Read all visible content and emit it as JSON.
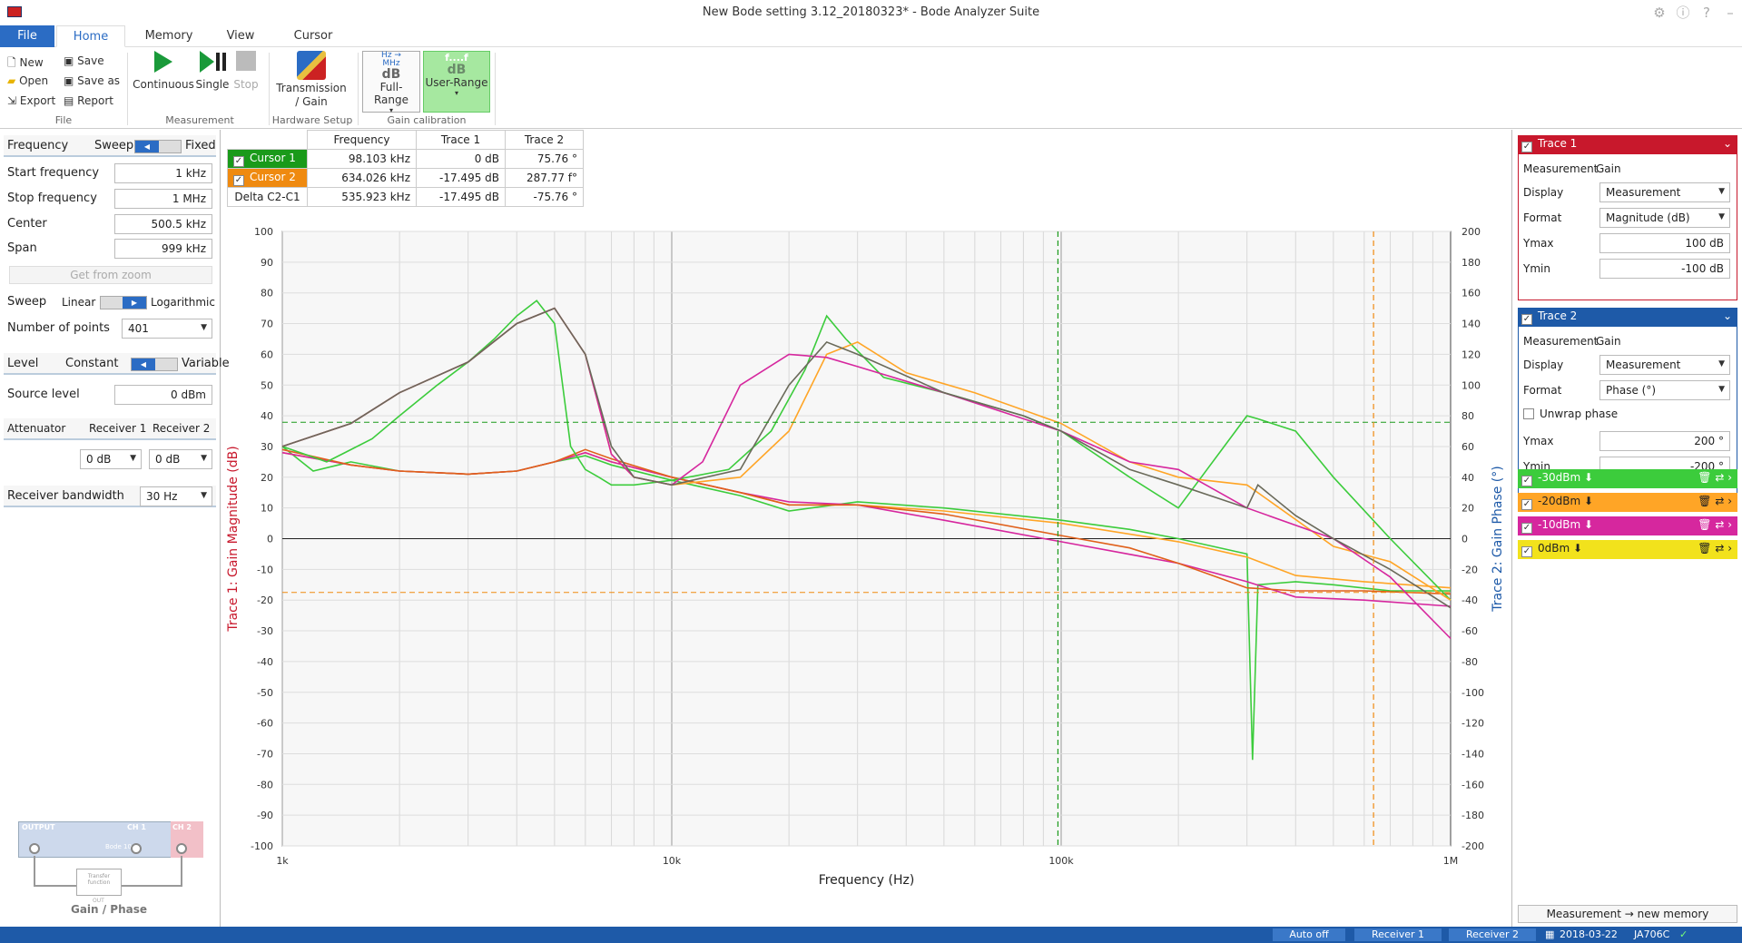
{
  "window": {
    "title": "New Bode setting 3.12_20180323* - Bode Analyzer Suite"
  },
  "tabs": [
    "File",
    "Home",
    "Memory",
    "View",
    "Cursor"
  ],
  "ribbon": {
    "file_items": [
      "New",
      "Open",
      "Export",
      "Save",
      "Save as",
      "Report"
    ],
    "file_group": "File",
    "continuous": "Continuous",
    "single": "Single",
    "stop": "Stop",
    "measurement_group": "Measurement",
    "transmission": "Transmission",
    "gain": "/ Gain",
    "hardware_group": "Hardware Setup",
    "full_range": "Full-Range",
    "user_range": "User-Range",
    "calib_group": "Gain calibration",
    "hz_label": "Hz",
    "mhz_label": "MHz",
    "db_label": "dB",
    "f_label": "f....f"
  },
  "left": {
    "frequency": "Frequency",
    "sweep": "Sweep",
    "fixed": "Fixed",
    "start_label": "Start frequency",
    "start_value": "1 kHz",
    "stop_label": "Stop frequency",
    "stop_value": "1 MHz",
    "center_label": "Center",
    "center_value": "500.5 kHz",
    "span_label": "Span",
    "span_value": "999 kHz",
    "get_from_zoom": "Get from zoom",
    "sweep_label": "Sweep",
    "linear": "Linear",
    "logarithmic": "Logarithmic",
    "points_label": "Number of points",
    "points_value": "401",
    "level": "Level",
    "constant": "Constant",
    "variable": "Variable",
    "source_label": "Source level",
    "source_value": "0 dBm",
    "attenuator": "Attenuator",
    "receiver1": "Receiver 1",
    "receiver2": "Receiver 2",
    "att1": "0 dB",
    "att2": "0 dB",
    "bandwidth_label": "Receiver bandwidth",
    "bandwidth_value": "30 Hz",
    "diagram_output": "OUTPUT",
    "diagram_ch1": "CH 1",
    "diagram_ch2": "CH 2",
    "diagram_device": "Bode 100",
    "diagram_tf": "Transfer function",
    "diagram_out": "OUT",
    "diagram_title": "Gain / Phase"
  },
  "cursor_table": {
    "headers": [
      "Frequency",
      "Trace 1",
      "Trace 2"
    ],
    "rows": [
      {
        "name": "Cursor 1",
        "freq": "98.103 kHz",
        "t1": "0 dB",
        "t2": "75.76 °",
        "color": "#1a9a1a"
      },
      {
        "name": "Cursor 2",
        "freq": "634.026 kHz",
        "t1": "-17.495 dB",
        "t2": "287.77 f°",
        "color": "#ef8a10"
      },
      {
        "name": "Delta C2-C1",
        "freq": "535.923 kHz",
        "t1": "-17.495 dB",
        "t2": "-75.76 °",
        "color": ""
      }
    ]
  },
  "right": {
    "trace1": {
      "title": "Trace 1",
      "measurement_label": "Measurement",
      "measurement": "Gain",
      "display_label": "Display",
      "display": "Measurement",
      "format_label": "Format",
      "format": "Magnitude (dB)",
      "ymax_label": "Ymax",
      "ymax": "100 dB",
      "ymin_label": "Ymin",
      "ymin": "-100 dB",
      "color": "#c8182c"
    },
    "trace2": {
      "title": "Trace 2",
      "measurement_label": "Measurement",
      "measurement": "Gain",
      "display_label": "Display",
      "display": "Measurement",
      "format_label": "Format",
      "format": "Phase (°)",
      "unwrap": "Unwrap phase",
      "ymax_label": "Ymax",
      "ymax": "200 °",
      "ymin_label": "Ymin",
      "ymin": "-200 °",
      "color": "#1e5aa8"
    },
    "memories": [
      {
        "label": "-30dBm",
        "color": "#3ccc3c"
      },
      {
        "label": "-20dBm",
        "color": "#ffa526"
      },
      {
        "label": "-10dBm",
        "color": "#d6279e"
      },
      {
        "label": "0dBm",
        "color": "#f2e21c"
      }
    ],
    "new_memory": "Measurement → new memory"
  },
  "status": {
    "auto": "Auto off",
    "r1": "Receiver 1",
    "r2": "Receiver 2",
    "date": "2018-03-22",
    "device": "JA706C"
  },
  "chart_data": {
    "type": "line",
    "xlabel": "Frequency (Hz)",
    "ylabel_left": "Trace 1: Gain Magnitude (dB)",
    "ylabel_right": "Trace 2: Gain Phase (°)",
    "xscale": "log",
    "xlim": [
      1000,
      1000000
    ],
    "ylim_left": [
      -100,
      100
    ],
    "ylim_right": [
      -200,
      200
    ],
    "x_ticks": [
      "1k",
      "10k",
      "100k",
      "1M"
    ],
    "y_ticks_left": [
      100,
      90,
      80,
      70,
      60,
      50,
      40,
      30,
      20,
      10,
      0,
      -10,
      -20,
      -30,
      -40,
      -50,
      -60,
      -70,
      -80,
      -90,
      -100
    ],
    "y_ticks_right": [
      200,
      180,
      160,
      140,
      120,
      100,
      80,
      60,
      40,
      20,
      0,
      -20,
      -40,
      -60,
      -80,
      -100,
      -120,
      -140,
      -160,
      -180,
      -200
    ],
    "cursor1_hz": 98103,
    "cursor2_hz": 634026,
    "cursor1_db": 37.9,
    "cursor2_db": -17.495,
    "series": [
      {
        "name": "-30dBm",
        "color": "#3ccc3c",
        "axis": "left",
        "x": [
          1000,
          1200,
          1500,
          2000,
          3000,
          4000,
          5000,
          6000,
          7000,
          10000,
          15000,
          20000,
          30000,
          50000,
          100000,
          150000,
          200000,
          300000,
          310000,
          320000,
          400000,
          500000,
          700000,
          1000000
        ],
        "y": [
          30,
          22,
          25,
          22,
          21,
          22,
          25,
          27,
          24,
          19,
          14,
          9,
          12,
          10,
          6,
          3,
          0,
          -5,
          -72,
          -15,
          -14,
          -15,
          -17,
          -17
        ]
      },
      {
        "name": "-20dBm",
        "color": "#ffa526",
        "axis": "left",
        "x": [
          1000,
          1500,
          2000,
          3000,
          4000,
          5000,
          6000,
          7000,
          10000,
          15000,
          20000,
          30000,
          50000,
          100000,
          200000,
          300000,
          400000,
          600000,
          1000000
        ],
        "y": [
          28,
          24,
          22,
          21,
          22,
          25,
          28,
          25,
          20,
          15,
          11,
          11,
          9,
          5,
          -1,
          -6,
          -12,
          -14,
          -16
        ]
      },
      {
        "name": "-10dBm",
        "color": "#d6279e",
        "axis": "left",
        "x": [
          1000,
          1500,
          2000,
          3000,
          4000,
          5000,
          6000,
          7000,
          10000,
          15000,
          20000,
          30000,
          50000,
          100000,
          200000,
          300000,
          400000,
          600000,
          1000000
        ],
        "y": [
          28,
          24,
          22,
          21,
          22,
          25,
          28,
          25,
          20,
          15,
          12,
          11,
          6,
          -1,
          -8,
          -14,
          -19,
          -20,
          -22
        ]
      },
      {
        "name": "Trace 1",
        "color": "#e0601a",
        "axis": "left",
        "x": [
          1000,
          1500,
          2000,
          3000,
          4000,
          5000,
          6000,
          7000,
          10000,
          15000,
          20000,
          30000,
          50000,
          100000,
          150000,
          200000,
          300000,
          400000,
          600000,
          1000000
        ],
        "y": [
          29,
          24,
          22,
          21,
          22,
          25,
          29,
          26,
          20,
          15,
          11,
          11,
          8,
          1,
          -3,
          -8,
          -16,
          -17,
          -17,
          -18
        ]
      },
      {
        "name": "-30dBm phase",
        "color": "#3ccc3c",
        "axis": "right",
        "x": [
          1000,
          1300,
          1700,
          2000,
          2500,
          3000,
          3500,
          4000,
          4500,
          5000,
          5500,
          6000,
          6500,
          7000,
          8000,
          10000,
          14000,
          18000,
          22000,
          25000,
          28000,
          35000,
          50000,
          80000,
          100000,
          150000,
          200000,
          300000,
          320000,
          400000,
          500000,
          700000,
          1000000
        ],
        "y": [
          60,
          50,
          65,
          80,
          100,
          115,
          130,
          145,
          155,
          140,
          60,
          45,
          40,
          35,
          35,
          38,
          45,
          70,
          110,
          145,
          130,
          105,
          95,
          80,
          70,
          40,
          20,
          80,
          78,
          70,
          40,
          0,
          -40
        ]
      },
      {
        "name": "-20dBm phase",
        "color": "#ffa526",
        "axis": "right",
        "x": [
          1000,
          1500,
          2000,
          3000,
          4000,
          5000,
          6000,
          7000,
          8000,
          10000,
          15000,
          20000,
          25000,
          30000,
          40000,
          60000,
          100000,
          150000,
          200000,
          300000,
          500000,
          700000,
          1000000
        ],
        "y": [
          60,
          75,
          95,
          115,
          140,
          150,
          120,
          55,
          40,
          35,
          40,
          70,
          120,
          128,
          108,
          95,
          75,
          50,
          40,
          35,
          -5,
          -15,
          -40
        ]
      },
      {
        "name": "-10dBm phase",
        "color": "#d6279e",
        "axis": "right",
        "x": [
          1000,
          1500,
          2000,
          3000,
          4000,
          5000,
          6000,
          7000,
          8000,
          10000,
          12000,
          15000,
          20000,
          25000,
          30000,
          50000,
          100000,
          150000,
          200000,
          300000,
          500000,
          700000,
          1000000
        ],
        "y": [
          60,
          75,
          95,
          115,
          140,
          150,
          120,
          55,
          40,
          35,
          50,
          100,
          120,
          118,
          112,
          95,
          70,
          50,
          45,
          20,
          0,
          -25,
          -65
        ]
      },
      {
        "name": "Trace 2",
        "color": "#6a6a5a",
        "axis": "right",
        "x": [
          1000,
          1500,
          2000,
          3000,
          4000,
          5000,
          6000,
          7000,
          8000,
          10000,
          15000,
          20000,
          25000,
          30000,
          50000,
          80000,
          100000,
          150000,
          200000,
          300000,
          320000,
          400000,
          500000,
          700000,
          1000000
        ],
        "y": [
          60,
          75,
          95,
          115,
          140,
          150,
          120,
          60,
          40,
          35,
          45,
          100,
          128,
          120,
          95,
          80,
          70,
          45,
          35,
          20,
          35,
          15,
          0,
          -20,
          -45
        ]
      }
    ]
  }
}
